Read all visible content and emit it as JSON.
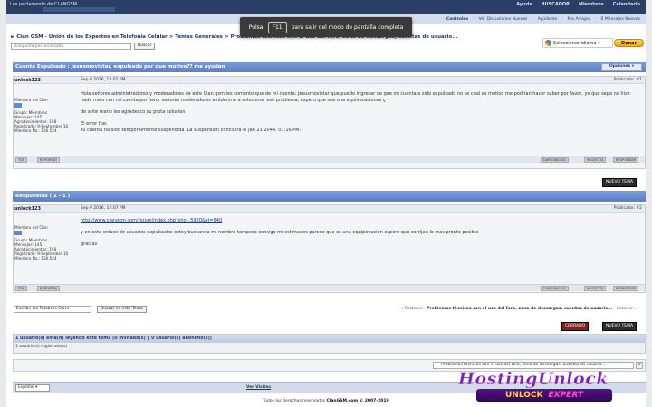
{
  "header": {
    "site_title": "Los peclamento de CLANGSM",
    "top_links": [
      "Ayuda",
      "BUSCADOR",
      "Miembros",
      "Calendario"
    ],
    "subnav": [
      "Controles",
      "Ver Discusiones Nuevas",
      "Ayúdante",
      "Mis Amigos",
      "0 Mensajes Nuevos"
    ]
  },
  "fullscreen_notice": {
    "pre": "Pulsa",
    "key": "F11",
    "post": "para salir del modo de pantalla completa"
  },
  "breadcrumb": [
    "Clan GSM - Unión de los Expertos en Telefonía Celular",
    "Temas Generales",
    "Problemas técnicos con el uso del foro, zona de descargas, cuentas de usuario..."
  ],
  "search": {
    "placeholder": "Búsqueda personalizada",
    "button": "Buscar",
    "google_label": "Google"
  },
  "translate": {
    "label": "Seleccionar idioma"
  },
  "donate": {
    "label": "Donar"
  },
  "thread": {
    "title": "Cuenta Expulsado : Jesusmovistar, expulsado por que motivo?? me ayudan",
    "options": "Opciones"
  },
  "post1": {
    "author": "unlock123",
    "date": "Sep 9 2016, 12:02 PM",
    "published": "Publicado:",
    "post_no": "#1",
    "side": [
      "Miembro del Clan",
      "Grupo: Miembros",
      "Mensajes: 145",
      "Agradecimientos: 198",
      "Registrado: 9-September 10",
      "Miembro No.: 130.524"
    ],
    "body": [
      "Hola señores administradores y moderadores de este Clan gsm les comento que de mi cuenta: Jesusmovistar que puedo ingresar de que mi cuenta a sido expulsado no se cual es motivo me podrían hacer saber por favor, yo que sepa no hize nada malo con mi cuenta por favor señores moderadores ayúdenme a solucionar ese problema, espero que sea una equivocaciones ç",
      "de ante mano les agradesco su prota solucion",
      "El error fue:",
      "Tu cuenta ha sido temporalmente suspendida. La suspensión concluirá el Jan 21 2044, 07:16 PM."
    ]
  },
  "post_buttons": {
    "top": "TOP",
    "report": "REPORTAR",
    "thanks": "DAR GRACIAS",
    "multi": "MULTICITA",
    "reply": "RESPONDER"
  },
  "new_topic": "NUEVO TEMA",
  "replies": {
    "title": "Respuestas ( 1 - 1 )"
  },
  "post2": {
    "author": "unlock123",
    "date": "Sep 9 2016, 12:07 PM",
    "published": "Publicado:",
    "post_no": "#2",
    "side": [
      "Miembro del Clan",
      "Grupo: Miembros",
      "Mensajes: 145",
      "Agradecimientos: 198",
      "Registrado: 9-September 10",
      "Miembro No.: 130.524"
    ],
    "link": "http://www.clangsm.com/forum/index.php?sho...5920&st=840",
    "body": [
      "y en este enlace de usuarios expulsados estoy buscando mi nombre tampoco consigo mi estimados parece que es una equipovacion espero que corrijan lo mas pronto posible",
      "gracias"
    ]
  },
  "lower": {
    "search_placeholder": "Escribe las Palabras Clave",
    "search_button": "Buscar en este Tema",
    "prev": "« Posterior ·",
    "nav_title": "Problemas técnicos con el uso del foro, zona de descargas, cuentas de usuario...",
    "next": "· Anterior »",
    "closed": "CERRADO"
  },
  "users": {
    "header": "1 usuario(s) está(n) leyendo este tema (0 invitado(s) y 0 usuario(s) anónimo(s))",
    "line": "1 usuario(s) registrado(s)"
  },
  "jump": {
    "selected": "|-- Problemas técnicos con el uso del foro, zona de descargas, cuentas de usuario...",
    "go": "Ir"
  },
  "footer": {
    "language": "Español",
    "view_link": "Ver Visitas",
    "copyright_pre": "Todos los derechos reservados",
    "copyright_site": "ClanGSM.com © 2007-2019"
  },
  "watermark": {
    "line1": "HostingUnlock",
    "line2a": "UNLOCK",
    "line2b": "EXPERT"
  }
}
